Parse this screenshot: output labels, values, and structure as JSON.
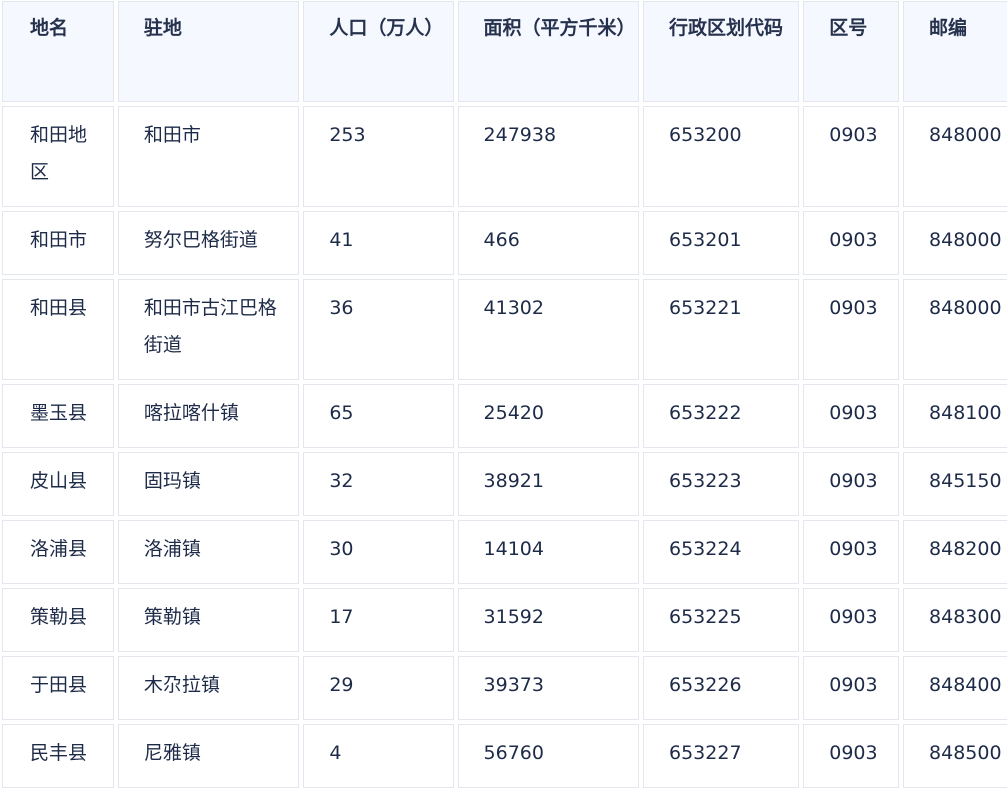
{
  "table": {
    "headers": [
      "地名",
      "驻地",
      "人口（万人）",
      "面积（平方千米）",
      "行政区划代码",
      "区号",
      "邮编"
    ],
    "rows": [
      [
        "和田地区",
        "和田市",
        "253",
        "247938",
        "653200",
        "0903",
        "848000"
      ],
      [
        "和田市",
        "努尔巴格街道",
        "41",
        "466",
        "653201",
        "0903",
        "848000"
      ],
      [
        "和田县",
        "和田市古江巴格街道",
        "36",
        "41302",
        "653221",
        "0903",
        "848000"
      ],
      [
        "墨玉县",
        "喀拉喀什镇",
        "65",
        "25420",
        "653222",
        "0903",
        "848100"
      ],
      [
        "皮山县",
        "固玛镇",
        "32",
        "38921",
        "653223",
        "0903",
        "845150"
      ],
      [
        "洛浦县",
        "洛浦镇",
        "30",
        "14104",
        "653224",
        "0903",
        "848200"
      ],
      [
        "策勒县",
        "策勒镇",
        "17",
        "31592",
        "653225",
        "0903",
        "848300"
      ],
      [
        "于田县",
        "木尕拉镇",
        "29",
        "39373",
        "653226",
        "0903",
        "848400"
      ],
      [
        "民丰县",
        "尼雅镇",
        "4",
        "56760",
        "653227",
        "0903",
        "848500"
      ]
    ]
  }
}
